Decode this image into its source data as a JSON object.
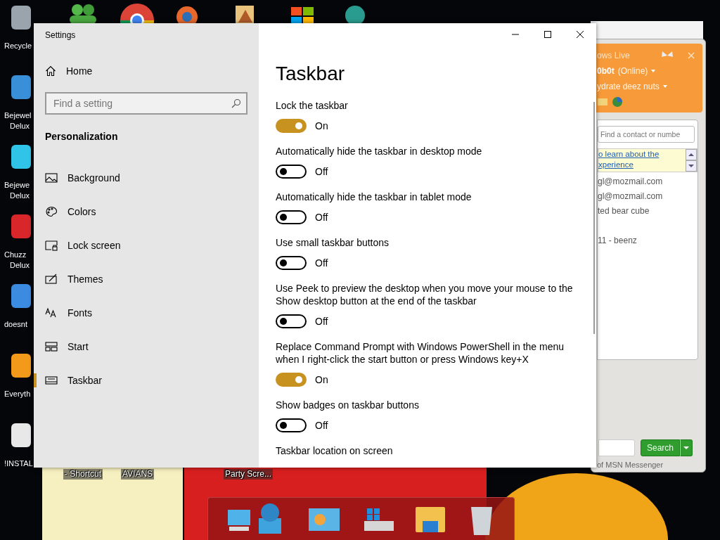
{
  "desktop_icons": [
    {
      "lines": [
        "Recycle"
      ]
    },
    {
      "lines": [
        "Bejewel",
        "Delux"
      ]
    },
    {
      "lines": [
        "Bejewe",
        "Delux"
      ]
    },
    {
      "lines": [
        "Chuzz",
        "Delux"
      ]
    },
    {
      "lines": [
        "doesnt"
      ]
    },
    {
      "lines": [
        "Everyth"
      ]
    },
    {
      "lines": [
        "!INSTAL"
      ]
    }
  ],
  "desktop_labels": [
    "- Shortcut",
    "AVIANS",
    "Party Scre..."
  ],
  "settings": {
    "title": "Settings",
    "home": "Home",
    "search": {
      "placeholder": "Find a setting"
    },
    "section": "Personalization",
    "nav": [
      {
        "label": "Background",
        "selected": false
      },
      {
        "label": "Colors",
        "selected": false
      },
      {
        "label": "Lock screen",
        "selected": false
      },
      {
        "label": "Themes",
        "selected": false
      },
      {
        "label": "Fonts",
        "selected": false
      },
      {
        "label": "Start",
        "selected": false
      },
      {
        "label": "Taskbar",
        "selected": true
      }
    ],
    "page_title": "Taskbar",
    "options": [
      {
        "kind": "toggle",
        "label": "Lock the taskbar",
        "on": true,
        "state": "On"
      },
      {
        "kind": "toggle",
        "label": "Automatically hide the taskbar in desktop mode",
        "on": false,
        "state": "Off"
      },
      {
        "kind": "toggle",
        "label": "Automatically hide the taskbar in tablet mode",
        "on": false,
        "state": "Off"
      },
      {
        "kind": "toggle",
        "label": "Use small taskbar buttons",
        "on": false,
        "state": "Off"
      },
      {
        "kind": "toggle",
        "label": "Use Peek to preview the desktop when you move your mouse to the Show desktop button at the end of the taskbar",
        "on": false,
        "state": "Off"
      },
      {
        "kind": "toggle",
        "label": "Replace Command Prompt with Windows PowerShell in the menu when I right-click the start button or press Windows key+X",
        "on": true,
        "state": "On"
      },
      {
        "kind": "toggle",
        "label": "Show badges on taskbar buttons",
        "on": false,
        "state": "Off"
      },
      {
        "kind": "heading",
        "label": "Taskbar location on screen"
      }
    ]
  },
  "messenger": {
    "title": "ows Live",
    "user": "0b0t",
    "status": "(Online)",
    "message": "ydrate deez nuts",
    "search": {
      "placeholder": "Find a contact or numbe"
    },
    "banner": [
      "o learn about the",
      "xperience"
    ],
    "contacts": [
      "gl@mozmail.com",
      "gl@mozmail.com",
      "ted bear cube",
      "11 - beenz"
    ],
    "search_button": "Search",
    "footer": "of MSN Messenger"
  }
}
